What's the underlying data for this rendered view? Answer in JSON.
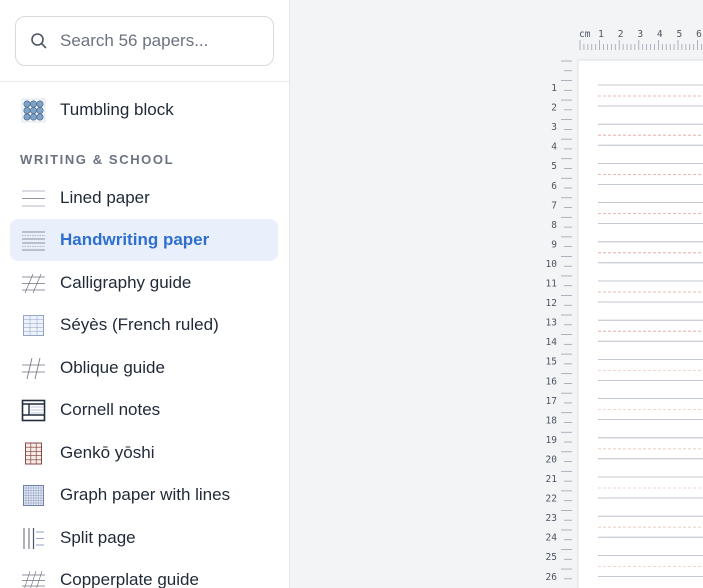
{
  "search": {
    "placeholder": "Search 56 papers..."
  },
  "sidebar": {
    "top_item": {
      "label": "Tumbling block",
      "icon": "tumbling-block-icon"
    },
    "section_title": "WRITING & SCHOOL",
    "items": [
      {
        "label": "Lined paper",
        "icon": "lined-paper-icon",
        "active": false
      },
      {
        "label": "Handwriting paper",
        "icon": "handwriting-paper-icon",
        "active": true
      },
      {
        "label": "Calligraphy guide",
        "icon": "calligraphy-guide-icon",
        "active": false
      },
      {
        "label": "Séyès (French ruled)",
        "icon": "seyes-icon",
        "active": false
      },
      {
        "label": "Oblique guide",
        "icon": "oblique-guide-icon",
        "active": false
      },
      {
        "label": "Cornell notes",
        "icon": "cornell-notes-icon",
        "active": false
      },
      {
        "label": "Genkō yōshi",
        "icon": "genko-yoshi-icon",
        "active": false
      },
      {
        "label": "Graph paper with lines",
        "icon": "graph-paper-lines-icon",
        "active": false
      },
      {
        "label": "Split page",
        "icon": "split-page-icon",
        "active": false
      },
      {
        "label": "Copperplate guide",
        "icon": "copperplate-guide-icon",
        "active": false
      }
    ]
  },
  "preview": {
    "ruler_unit": "cm",
    "top_ruler_labels": [
      "1",
      "2",
      "3",
      "4",
      "5",
      "6"
    ],
    "left_ruler_labels": [
      "1",
      "2",
      "3",
      "4",
      "5",
      "6",
      "7",
      "8",
      "9",
      "10",
      "11",
      "12",
      "13",
      "14",
      "15",
      "16",
      "17",
      "18",
      "19",
      "20",
      "21",
      "22",
      "23",
      "24",
      "25",
      "26"
    ]
  },
  "colors": {
    "accent": "#2f6fd0",
    "active_bg": "#e9f0fc",
    "line_solid": "#aeb5c2",
    "line_dash_red": "#e3a196",
    "line_dash_peach": "#eec7b9"
  }
}
